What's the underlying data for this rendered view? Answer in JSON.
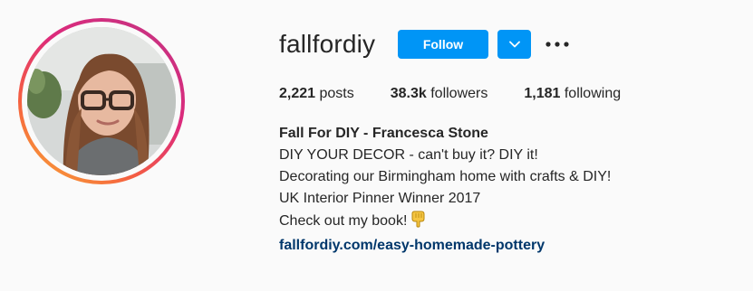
{
  "profile": {
    "username": "fallfordiy",
    "follow_label": "Follow",
    "stats": {
      "posts_count": "2,221",
      "posts_label": " posts",
      "followers_count": "38.3k",
      "followers_label": " followers",
      "following_count": "1,181",
      "following_label": " following"
    },
    "bio": {
      "full_name": "Fall For DIY - Francesca Stone",
      "lines": [
        "DIY YOUR DECOR - can't buy it? DIY it!",
        "Decorating our Birmingham home with crafts & DIY!",
        "UK Interior Pinner Winner 2017",
        "Check out my book!"
      ],
      "link": "fallfordiy.com/easy-homemade-pottery"
    }
  },
  "colors": {
    "primary_button": "#0095f6",
    "link": "#00376b",
    "text": "#262626",
    "background": "#fafafa"
  },
  "icons": {
    "dropdown": "chevron-down-icon",
    "more": "more-options-icon",
    "emoji": "pointing-down-hand-emoji"
  }
}
